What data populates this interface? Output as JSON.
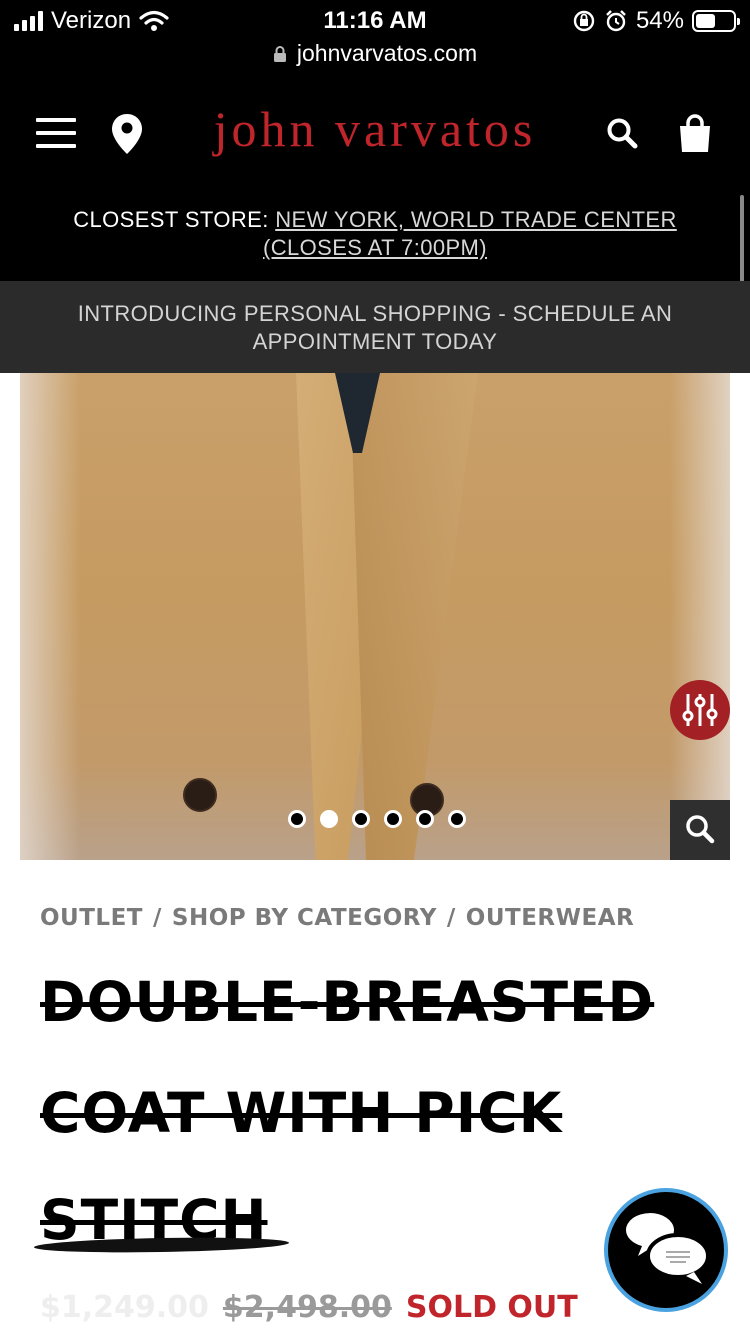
{
  "status_bar": {
    "carrier": "Verizon",
    "time": "11:16 AM",
    "battery_percent": "54%",
    "battery_level": 0.54,
    "url": "johnvarvatos.com"
  },
  "header": {
    "logo": "john varvatos",
    "icons": [
      "menu-icon",
      "location-pin-icon",
      "search-icon",
      "shopping-bag-icon"
    ]
  },
  "store_bar": {
    "label": "CLOSEST STORE:",
    "link": "NEW YORK, WORLD TRADE CENTER (CLOSES AT 7:00PM)"
  },
  "promo": {
    "text": "INTRODUCING PERSONAL SHOPPING - SCHEDULE AN APPOINTMENT TODAY"
  },
  "carousel": {
    "slide_count": 6,
    "active_index": 1
  },
  "breadcrumb": {
    "items": [
      "OUTLET",
      "SHOP BY CATEGORY",
      "OUTERWEAR"
    ],
    "separator": "/"
  },
  "product": {
    "title_lines": [
      "DOUBLE-BREASTED",
      "COAT WITH PICK",
      "STITCH"
    ],
    "sale_price": "$1,249.00",
    "original_price": "$2,498.00",
    "status": "SOLD OUT"
  },
  "colors": {
    "brand_red": "#c0252b",
    "header_bg": "#000000",
    "promo_bg": "#2b2b2b",
    "chat_border": "#4aa3e0"
  }
}
